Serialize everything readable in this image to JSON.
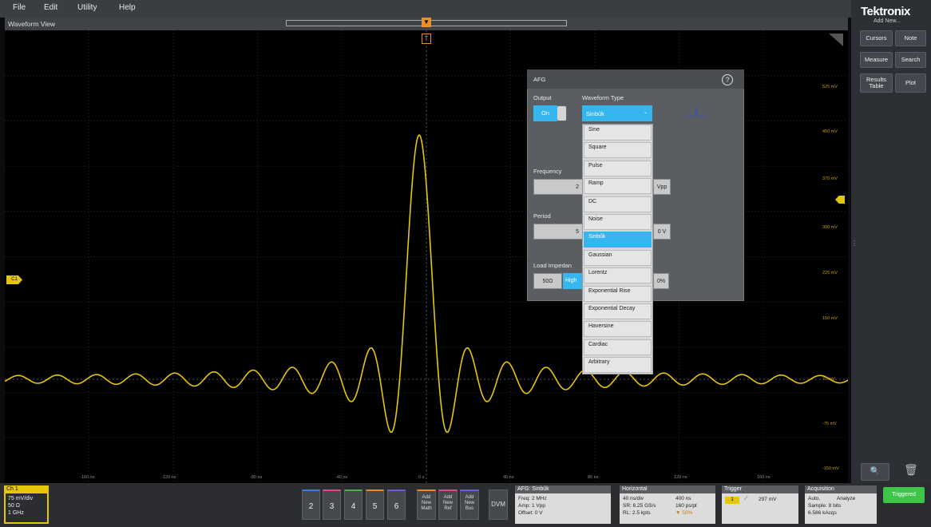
{
  "menu": [
    "File",
    "Edit",
    "Utility",
    "Help"
  ],
  "brand": "Tektronix",
  "add_new": "Add New...",
  "right_buttons": {
    "cursors": "Cursors",
    "note": "Note",
    "measure": "Measure",
    "search": "Search",
    "results_table": "Results Table",
    "plot": "Plot"
  },
  "waveform_view": {
    "title": "Waveform View",
    "trigger_marker": "T",
    "ch_marker": "C1",
    "v_labels": [
      "525 mV",
      "450 mV",
      "375 mV",
      "300 mV",
      "225 mV",
      "150 mV",
      "75 mV",
      "-75 mV",
      "-150 mV"
    ],
    "h_labels": [
      "-160 ns",
      "-120 ns",
      "-80 ns",
      "-40 ns",
      "0 s",
      "40 ns",
      "80 ns",
      "120 ns",
      "160 ns"
    ]
  },
  "afg": {
    "title": "AFG",
    "help": "?",
    "output_label": "Output",
    "output_state": "On",
    "waveform_type_label": "Waveform Type",
    "selected": "Sinbûk",
    "frequency_label": "Frequency",
    "frequency_value": "2",
    "amplitude_unit": "Vpp",
    "period_label": "Period",
    "period_value": "5",
    "offset_unit": "0 V",
    "load_label": "Load Impedan",
    "load_50": "50Ω",
    "load_high": "High",
    "symmetry": "0%",
    "options": [
      "Sine",
      "Square",
      "Pulse",
      "Ramp",
      "DC",
      "Noise",
      "Sinbûk",
      "Gaussian",
      "Lorentz",
      "Exponential Rise",
      "Exponential Decay",
      "Haversine",
      "Cardiac",
      "Arbitrary"
    ]
  },
  "ch1": {
    "title": "Ch 1",
    "scale": "75 mV/div",
    "impedance": "50 Ω",
    "bandwidth": "1 GHz"
  },
  "channel_buttons": [
    "2",
    "3",
    "4",
    "5",
    "6"
  ],
  "add_buttons": {
    "math": "Add New Math",
    "ref": "Add New Ref",
    "bus": "Add New Bus",
    "dvm": "DVM"
  },
  "afg_badge": {
    "title": "AFG: Sinbûk",
    "freq": "Freq: 2 MHz",
    "amp": "Amp: 1 Vpp",
    "offset": "Offset: 0 V"
  },
  "horizontal": {
    "title": "Horizontal",
    "scale": "40 ns/div",
    "length": "400 ns",
    "sr": "SR: 6.25 GS/s",
    "ptpt": "160 ps/pt",
    "rl": "RL: 2.5 kpts",
    "pos": "▼ 50%"
  },
  "trigger": {
    "title": "Trigger",
    "channel": "1",
    "level": "297 mV"
  },
  "acquisition": {
    "title": "Acquisition",
    "mode": "Auto,",
    "analyze": "Analyze",
    "sample": "Sample: 8 bits",
    "acqs": "6.586 kAcqs"
  },
  "triggered": "Triggered",
  "chart_data": {
    "type": "line",
    "title": "",
    "series": [
      {
        "name": "",
        "color": "#e6c60a",
        "function": "sinc",
        "peak_mV": 405,
        "baseline_mV": -15
      }
    ],
    "x_ticks": [
      "-160 ns",
      "-120 ns",
      "-80 ns",
      "-40 ns",
      "0 s",
      "40 ns",
      "80 ns",
      "120 ns",
      "160 ns"
    ],
    "y_ticks": [
      "525 mV",
      "450 mV",
      "375 mV",
      "300 mV",
      "225 mV",
      "150 mV",
      "75 mV",
      "-75 mV",
      "-150 mV"
    ],
    "grid": true
  }
}
